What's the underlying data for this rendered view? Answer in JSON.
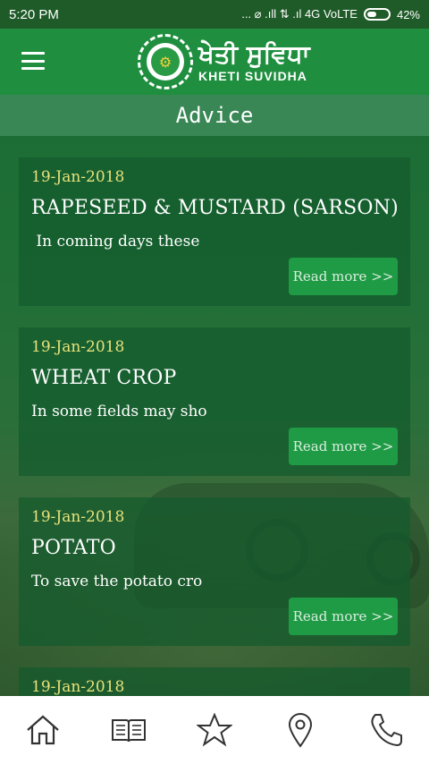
{
  "status_bar": {
    "time": "5:20 PM",
    "indicators": "... ⌀ .ıll ⇅ .ıl 4G VoLTE",
    "battery": "42%"
  },
  "app": {
    "logo_title": "ਖੇਤੀ ਸੁਵਿਧਾ",
    "logo_subtitle": "KHETI SUVIDHA",
    "menu_icon": "hamburger-menu-icon"
  },
  "page": {
    "title": "Advice"
  },
  "advice_cards": [
    {
      "date": "19-Jan-2018",
      "title": "RAPESEED & MUSTARD (SARSON)",
      "excerpt": " In coming days these",
      "read_more": "Read more >>"
    },
    {
      "date": "19-Jan-2018",
      "title": "WHEAT CROP",
      "excerpt": "In some fields may sho",
      "read_more": "Read more >>"
    },
    {
      "date": "19-Jan-2018",
      "title": "POTATO",
      "excerpt": "To save the potato cro",
      "read_more": "Read more >>"
    },
    {
      "date": "19-Jan-2018",
      "title": "",
      "excerpt": "",
      "read_more": ""
    }
  ],
  "bottom_nav": [
    {
      "icon": "home-icon"
    },
    {
      "icon": "book-icon"
    },
    {
      "icon": "star-icon"
    },
    {
      "icon": "location-pin-icon"
    },
    {
      "icon": "phone-icon"
    }
  ],
  "colors": {
    "app_bar": "#1f8f3f",
    "status_bar": "#1f5b28",
    "date_text": "#e9e27a",
    "button": "#1f9a45"
  }
}
